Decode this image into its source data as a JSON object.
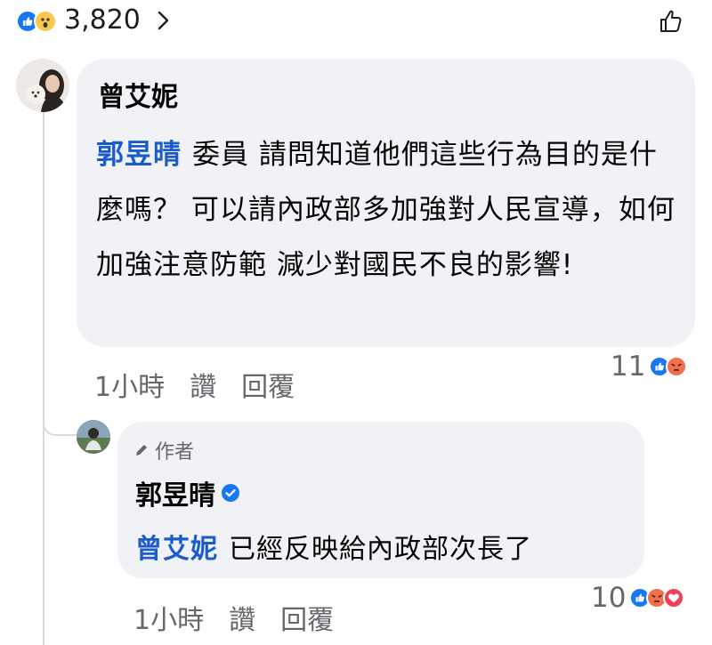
{
  "summary": {
    "reaction_count": "3,820",
    "reactions": [
      "like-icon",
      "wow-icon"
    ]
  },
  "comment": {
    "author": "曾艾妮",
    "mention": "郭昱晴",
    "text": "委員 請問知道他們這些行為目的是什麼嗎？ 可以請內政部多加強對人民宣導，如何加強注意防範 減少對國民不良的影響!",
    "time": "1小時",
    "like_label": "讚",
    "reply_label": "回覆",
    "reaction_count": "11",
    "reactions": [
      "like-icon",
      "angry-icon"
    ]
  },
  "reply": {
    "badge": "作者",
    "author": "郭昱晴",
    "mention": "曾艾妮",
    "text": "已經反映給內政部次長了",
    "time": "1小時",
    "like_label": "讚",
    "reply_label": "回覆",
    "reaction_count": "10",
    "reactions": [
      "like-icon",
      "angry-icon",
      "love-icon"
    ]
  },
  "colors": {
    "accent": "#1877f2",
    "mention": "#1a5cc9",
    "bubble": "#f0f2f5",
    "muted": "#65676b"
  }
}
